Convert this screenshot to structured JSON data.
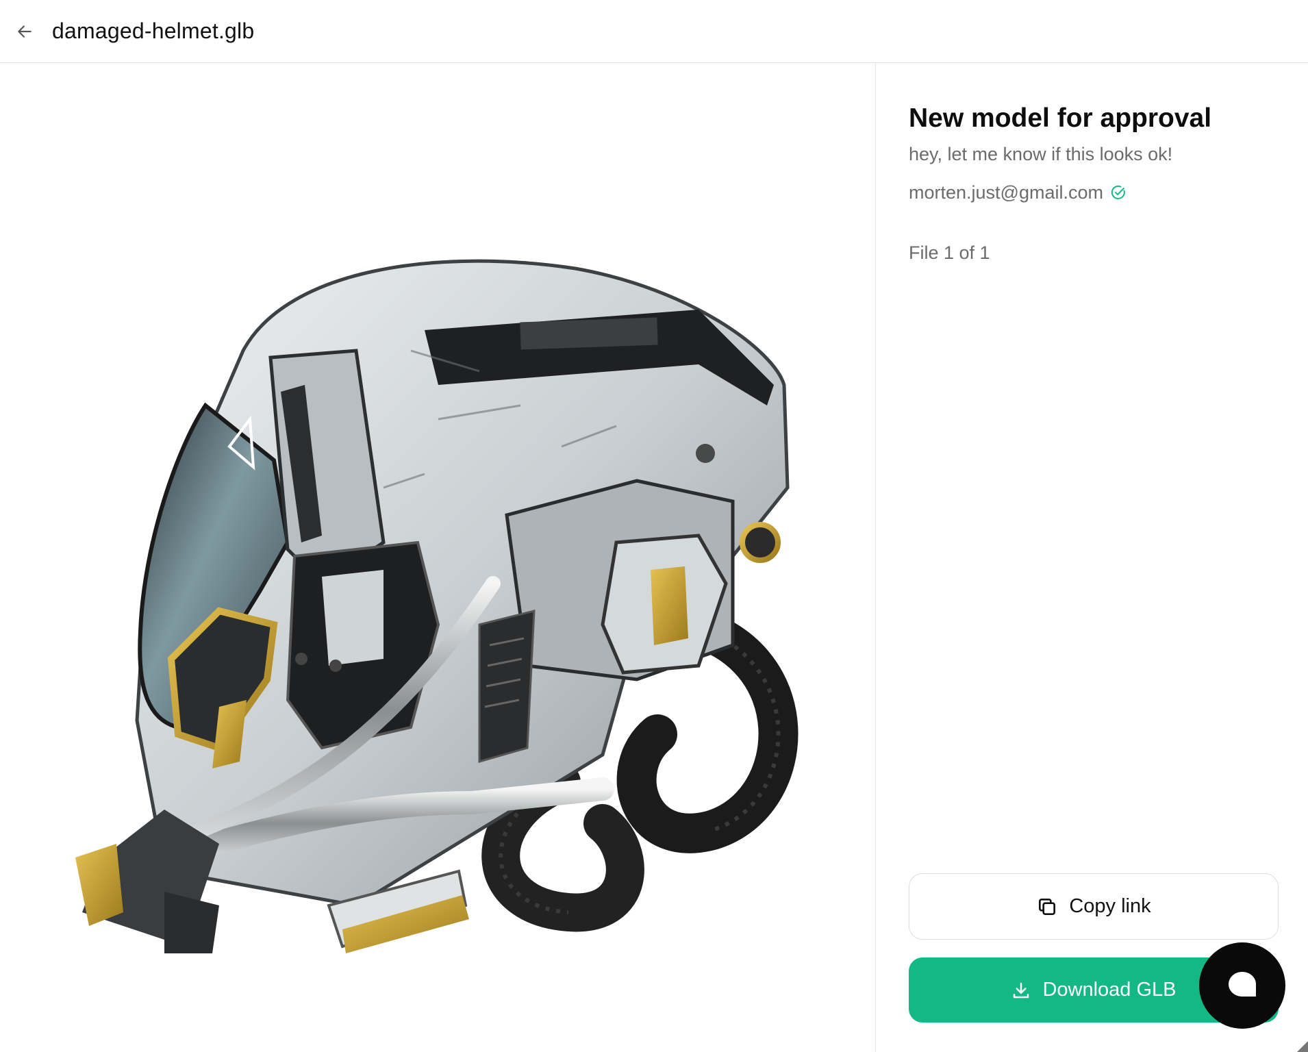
{
  "header": {
    "back_icon": "arrow-left-icon",
    "file_name": "damaged-helmet.glb"
  },
  "viewer": {
    "model_name": "damaged-helmet.glb",
    "accent_colors": {
      "shell": "#d7dcdf",
      "visor": "#6f8a93",
      "gold": "#c7a234",
      "hose": "#1b1b1b"
    }
  },
  "sidebar": {
    "title": "New model for approval",
    "message": "hey, let me know if this looks ok!",
    "email": "morten.just@gmail.com",
    "verified_icon": "check-circle-icon",
    "verified_color": "#19b883",
    "file_count": "File 1 of 1"
  },
  "actions": {
    "copy_label": "Copy link",
    "copy_icon": "copy-icon",
    "download_label": "Download GLB",
    "download_icon": "download-icon",
    "download_color": "#13b884"
  },
  "chat": {
    "icon": "chat-bubble-icon"
  }
}
